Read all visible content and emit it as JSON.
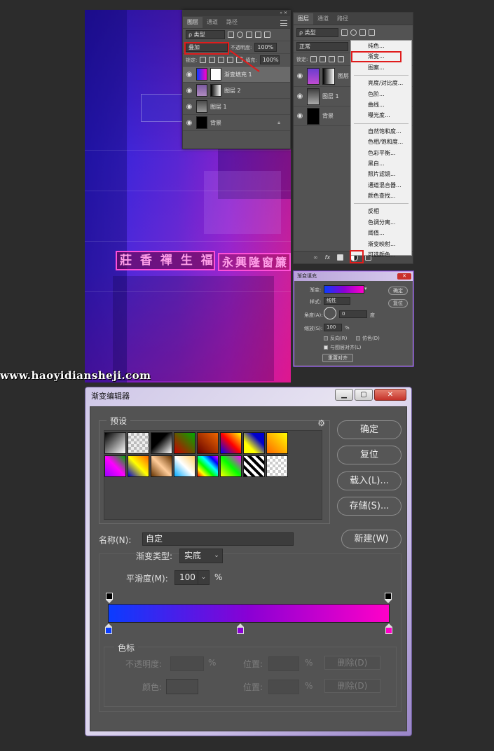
{
  "layers_panel_1": {
    "tabs": [
      "图层",
      "通道",
      "路径"
    ],
    "filter_kind": "ρ 类型",
    "blend_mode": "叠加",
    "opacity_label": "不透明度:",
    "opacity_value": "100%",
    "lock_label": "锁定:",
    "fill_label": "填充:",
    "fill_value": "100%",
    "layers": [
      {
        "name": "渐变填充 1"
      },
      {
        "name": "图层 2"
      },
      {
        "name": "图层 1"
      },
      {
        "name": "背景"
      }
    ]
  },
  "photo": {
    "sign_left": "莊 香 禪 生 福",
    "sign_right": "永興隆窗簾"
  },
  "layers_panel_2": {
    "tabs": [
      "图层",
      "通道",
      "路径"
    ],
    "filter_kind": "ρ 类型",
    "blend_mode": "正常",
    "lock_label": "锁定:",
    "layers": [
      {
        "name": "图层"
      },
      {
        "name": "图层 1"
      },
      {
        "name": "背景"
      }
    ],
    "bottom_fx": "fx"
  },
  "context_menu": {
    "groups": [
      [
        "纯色...",
        "渐变...",
        "图案..."
      ],
      [
        "亮度/对比度...",
        "色阶...",
        "曲线...",
        "曝光度..."
      ],
      [
        "自然饱和度...",
        "色相/饱和度...",
        "色彩平衡...",
        "黑白...",
        "照片滤镜...",
        "通道混合器...",
        "颜色查找..."
      ],
      [
        "反相",
        "色调分离...",
        "阈值...",
        "渐变映射...",
        "可选颜色..."
      ]
    ]
  },
  "gradient_fill_dialog": {
    "title": "渐变填充",
    "gradient_label": "渐变:",
    "style_label": "样式:",
    "style_value": "线性",
    "angle_label": "角度(A):",
    "angle_value": "0",
    "angle_unit": "度",
    "scale_label": "缩放(S):",
    "scale_value": "100",
    "scale_unit": "%",
    "reverse_label": "反向(R)",
    "dither_label": "仿色(D)",
    "align_label": "与图层对齐(L)",
    "reset_align_label": "重置对齐",
    "ok_label": "确定",
    "reset_label": "复位"
  },
  "watermark": "www.haoyidiansheji.com",
  "gradient_editor": {
    "title": "渐变编辑器",
    "presets_label": "预设",
    "ok_label": "确定",
    "reset_label": "复位",
    "load_label": "载入(L)...",
    "save_label": "存储(S)...",
    "name_label": "名称(N):",
    "name_value": "自定",
    "new_label": "新建(W)",
    "type_label": "渐变类型:",
    "type_value": "实底",
    "smoothness_label": "平滑度(M):",
    "smoothness_value": "100",
    "smoothness_unit": "%",
    "stops_label": "色标",
    "opacity_label": "不透明度:",
    "opacity_unit": "%",
    "color_label": "颜色:",
    "location_label": "位置:",
    "location_unit": "%",
    "delete_label": "删除(D)",
    "color_stops": [
      "#0a3cff",
      "#8a00d4",
      "#ff00c8"
    ]
  },
  "colors": {
    "panel_bg": "#535353",
    "highlight_red": "#e01c1c",
    "gradient_start": "#0a3cff",
    "gradient_mid": "#8a00d4",
    "gradient_end": "#ff00c8"
  }
}
